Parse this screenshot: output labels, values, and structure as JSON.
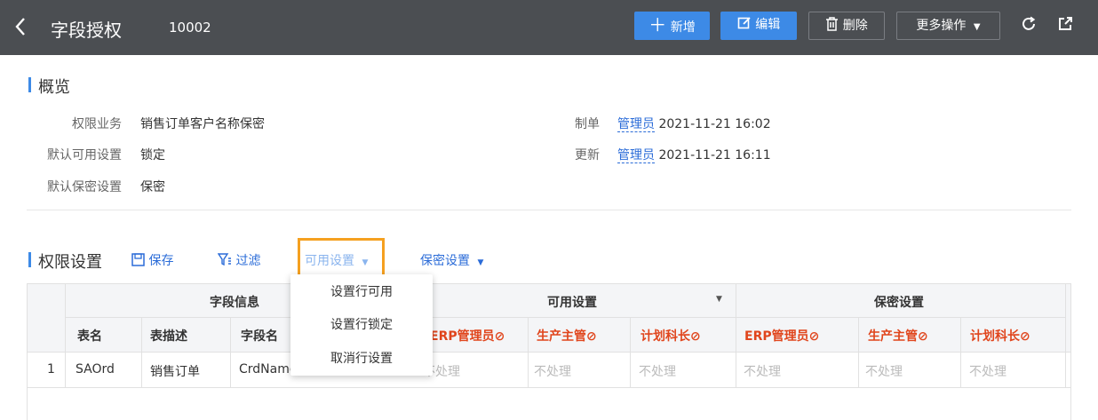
{
  "header": {
    "title": "字段授权",
    "code": "10002",
    "buttons": {
      "add": "新增",
      "edit": "编辑",
      "delete": "删除",
      "more": "更多操作"
    }
  },
  "overview": {
    "section_title": "概览",
    "fields": [
      {
        "label": "权限业务",
        "value": "销售订单客户名称保密"
      },
      {
        "label": "默认可用设置",
        "value": "锁定"
      },
      {
        "label": "默认保密设置",
        "value": "保密"
      }
    ],
    "created": {
      "label": "制单",
      "user": "管理员",
      "time": "2021-11-21 16:02"
    },
    "updated": {
      "label": "更新",
      "user": "管理员",
      "time": "2021-11-21 16:11"
    }
  },
  "permission": {
    "section_title": "权限设置",
    "toolbar": {
      "save": "保存",
      "filter": "过滤",
      "available_settings": "可用设置",
      "secret_settings": "保密设置"
    },
    "dropdown_items": [
      "设置行可用",
      "设置行锁定",
      "取消行设置"
    ],
    "group_headers": {
      "field_info": "字段信息",
      "available": "可用设置",
      "secret": "保密设置"
    },
    "columns": {
      "table_name": "表名",
      "table_desc": "表描述",
      "field_name": "字段名",
      "role1": "ERP管理员",
      "role2": "生产主管",
      "role3": "计划科长"
    },
    "rows": [
      {
        "no": "1",
        "table_name": "SAOrd",
        "table_desc": "销售订单",
        "field_name": "CrdName",
        "avail1": "不处理",
        "avail2": "不处理",
        "avail3": "不处理",
        "secret1": "不处理",
        "secret2": "不处理",
        "secret3": "不处理"
      }
    ]
  },
  "colors": {
    "header_bg": "#4b4e52",
    "accent": "#3d8ae6",
    "role_red": "#e0451c",
    "highlight": "#f5a020"
  }
}
